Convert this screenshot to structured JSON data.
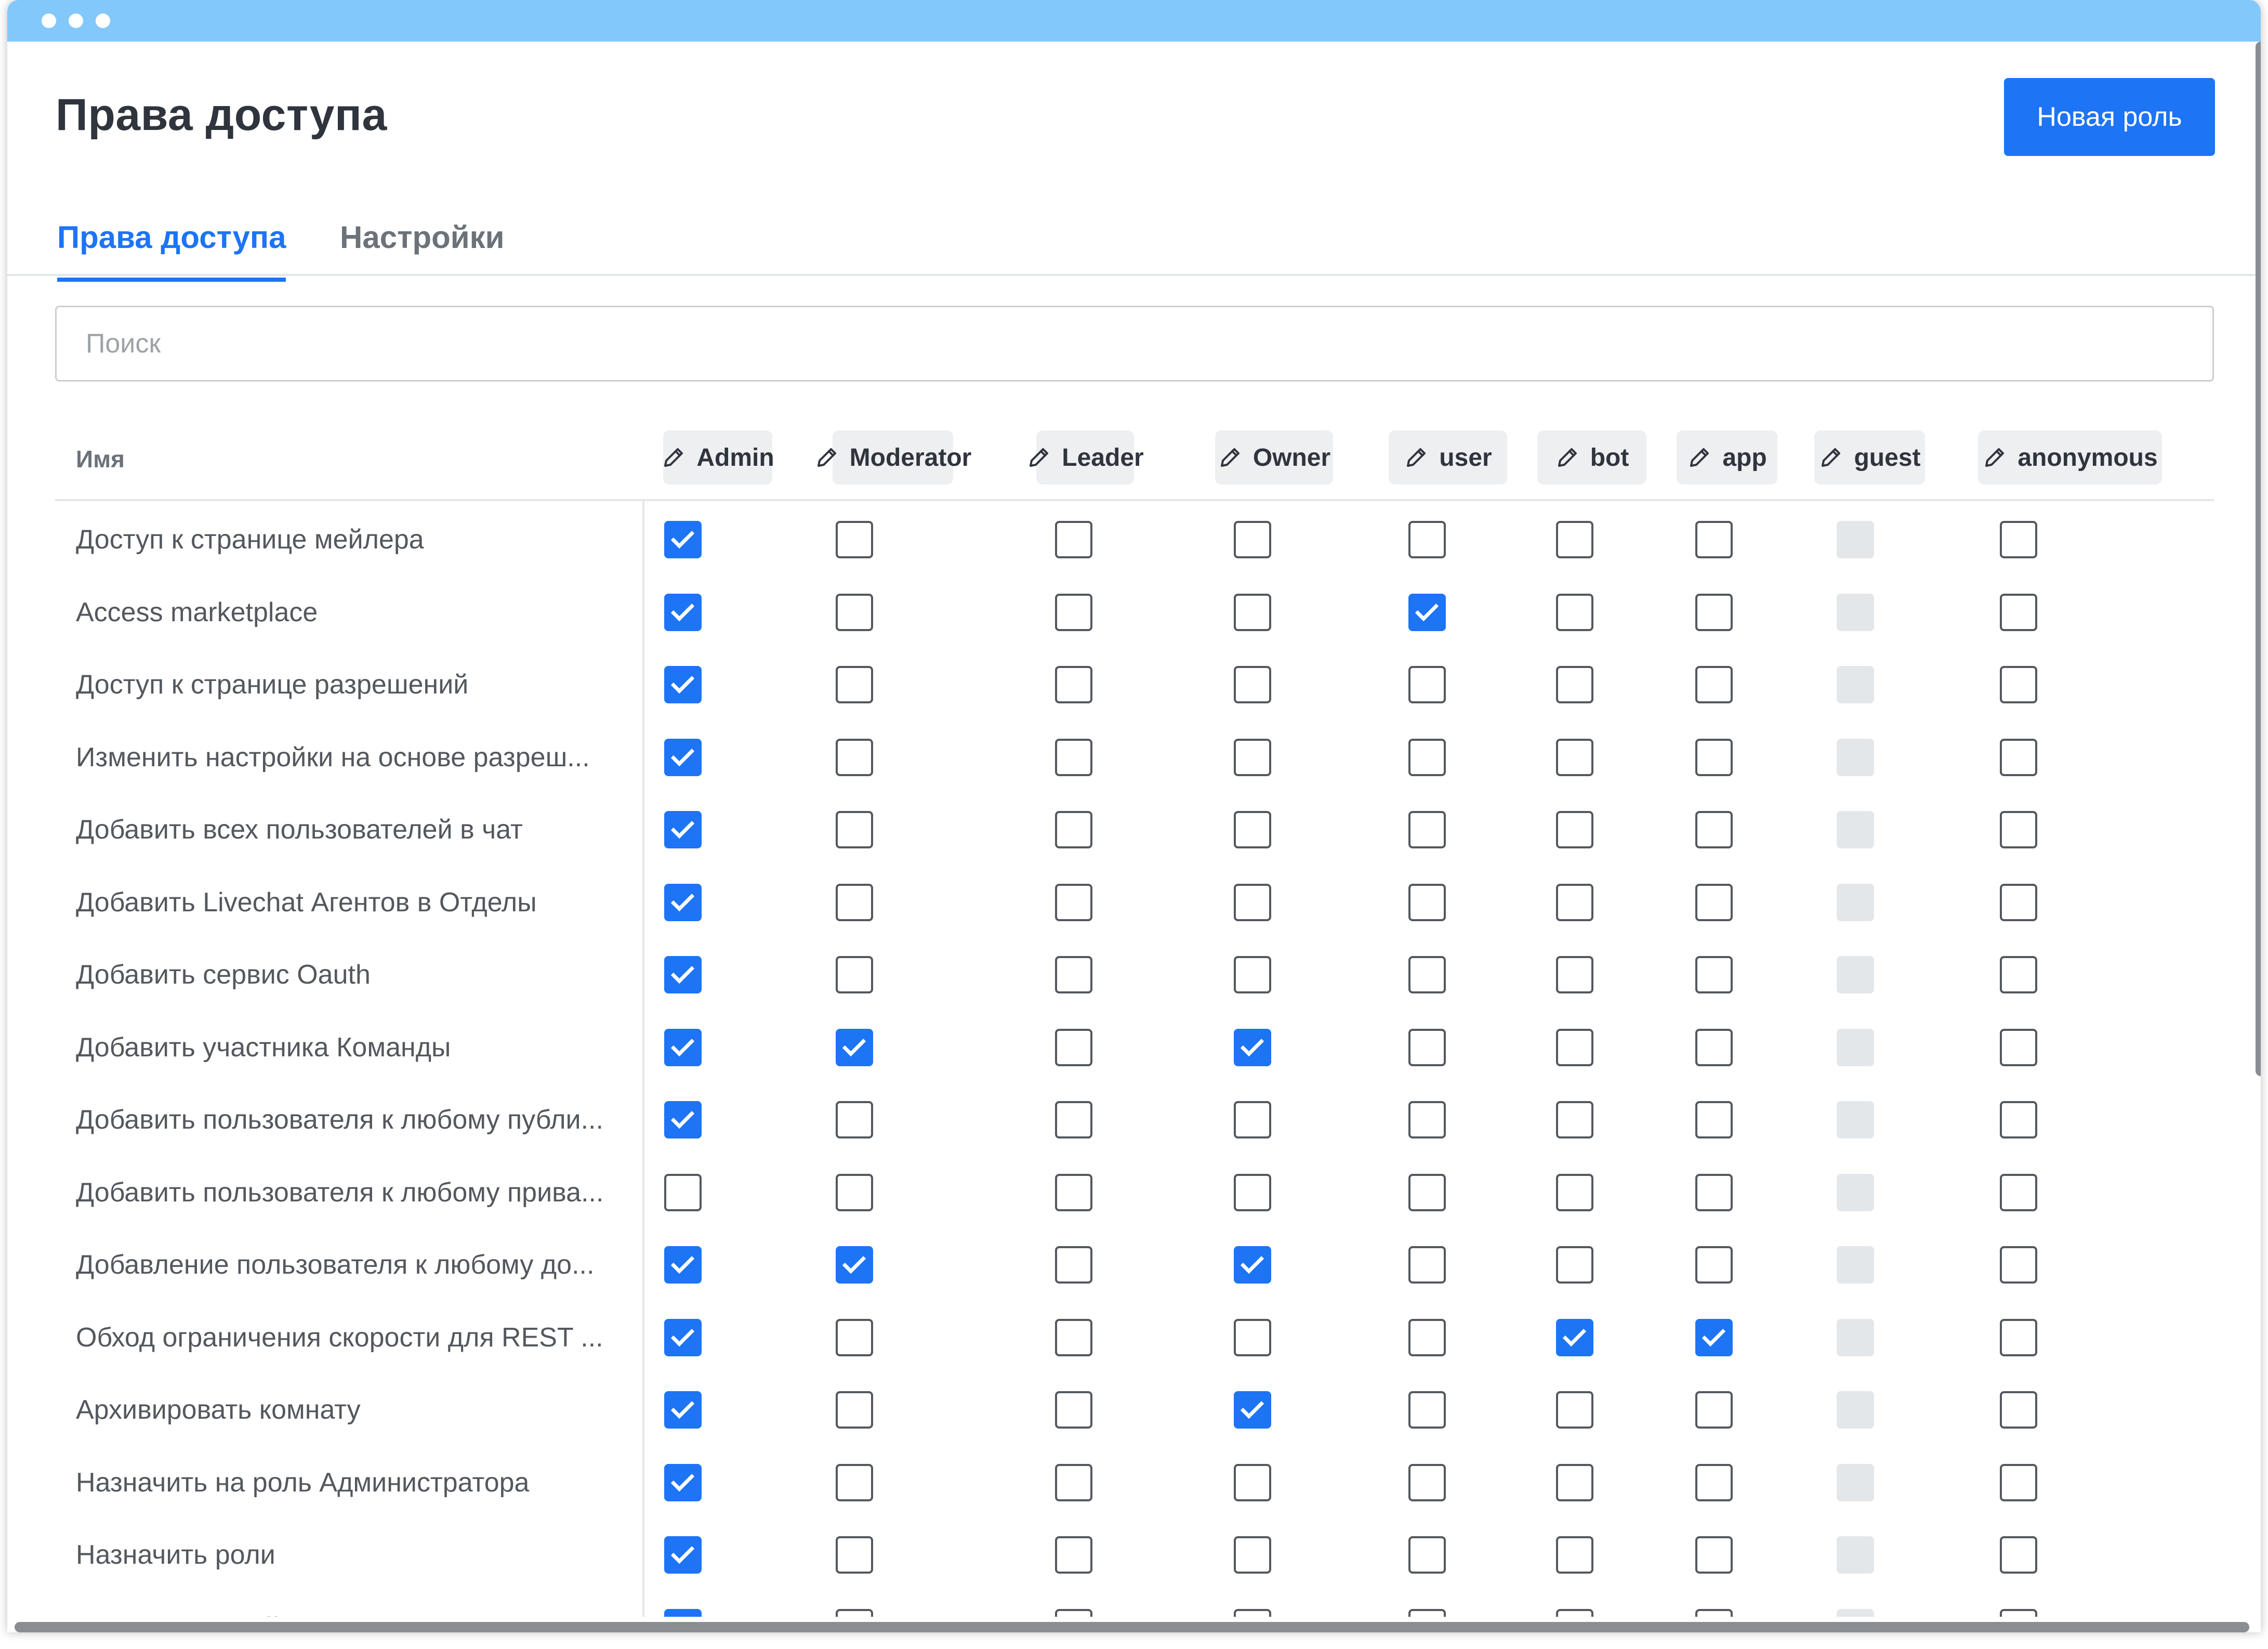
{
  "page": {
    "title": "Права доступа",
    "new_role_label": "Новая роль"
  },
  "tabs": [
    {
      "label": "Права доступа",
      "active": true
    },
    {
      "label": "Настройки",
      "active": false
    }
  ],
  "search": {
    "placeholder": "Поиск",
    "value": ""
  },
  "table": {
    "name_header": "Имя",
    "roles": [
      "Admin",
      "Moderator",
      "Leader",
      "Owner",
      "user",
      "bot",
      "app",
      "guest",
      "anonymous"
    ],
    "disabled_role": "guest",
    "rows": [
      {
        "label": "Доступ к странице мейлера",
        "checked": [
          "Admin"
        ]
      },
      {
        "label": "Access marketplace",
        "checked": [
          "Admin",
          "user"
        ]
      },
      {
        "label": "Доступ к странице разрешений",
        "checked": [
          "Admin"
        ]
      },
      {
        "label": "Изменить настройки на основе разреш...",
        "checked": [
          "Admin"
        ]
      },
      {
        "label": "Добавить всех пользователей в чат",
        "checked": [
          "Admin"
        ]
      },
      {
        "label": "Добавить Livechat Агентов в Отделы",
        "checked": [
          "Admin"
        ]
      },
      {
        "label": "Добавить сервис Oauth",
        "checked": [
          "Admin"
        ]
      },
      {
        "label": "Добавить участника Команды",
        "checked": [
          "Admin",
          "Moderator",
          "Owner"
        ]
      },
      {
        "label": "Добавить пользователя к любому публи...",
        "checked": [
          "Admin"
        ]
      },
      {
        "label": "Добавить пользователя к любому прива...",
        "checked": []
      },
      {
        "label": "Добавление пользователя к любому до...",
        "checked": [
          "Admin",
          "Moderator",
          "Owner"
        ]
      },
      {
        "label": "Обход ограничения скорости для REST ...",
        "checked": [
          "Admin",
          "bot",
          "app"
        ]
      },
      {
        "label": "Архивировать комнату",
        "checked": [
          "Admin",
          "Owner"
        ]
      },
      {
        "label": "Назначить на роль Администратора",
        "checked": [
          "Admin"
        ]
      },
      {
        "label": "Назначить роли",
        "checked": [
          "Admin"
        ]
      },
      {
        "label": "Автоматический перевод",
        "checked": [
          "Admin"
        ]
      }
    ]
  },
  "colors": {
    "accent": "#1d74f5",
    "titlebar": "#82c8fb",
    "chip_bg": "#eeeff1"
  },
  "icons": {
    "role_chip": "pencil-icon"
  }
}
